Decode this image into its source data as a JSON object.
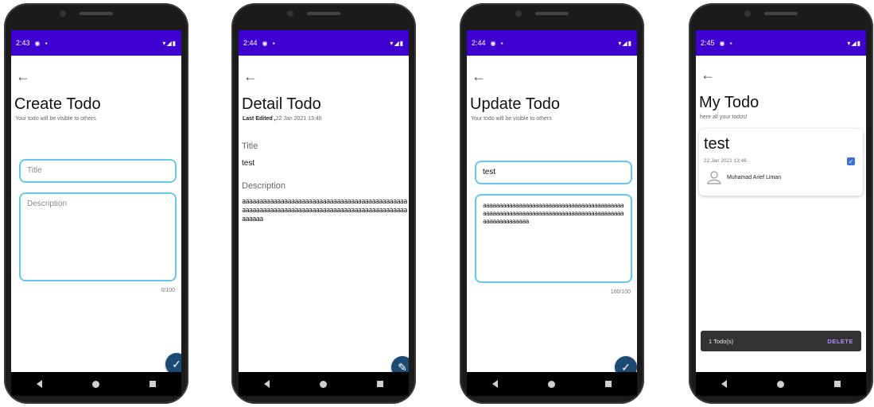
{
  "status_times": [
    "2:43",
    "2:44",
    "2:44",
    "2:45"
  ],
  "create": {
    "title": "Create Todo",
    "subtitle": "Your todo will be visible to others",
    "title_placeholder": "Title",
    "description_placeholder": "Description",
    "counter": "0/100"
  },
  "detail": {
    "title": "Detail Todo",
    "last_edited_label": "Last Edited ,",
    "last_edited_value": "22 Jan 2021 13:46",
    "title_label": "Title",
    "title_value": "test",
    "description_label": "Description",
    "description_value": "aaaaaaaaaaaaaaaaaaaaaaaaaaaaaaaaaaaaaaaaaaaaaaaaaaaaaaaaaaaaaaaaaaaaaaaaaaaaaaaaaaaaaaaaaaaaaaaaaaaa"
  },
  "update": {
    "title": "Update Todo",
    "subtitle": "Your todo will be visible to others",
    "title_value": "test",
    "description_value": "aaaaaaaaaaaaaaaaaaaaaaaaaaaaaaaaaaaaaaaaaaaaaaaaaaaaaaaaaaaaaaaaaaaaaaaaaaaaaaaaaaaaaaaaaaaaaaaaaaaa",
    "counter": "100/100"
  },
  "list": {
    "title": "My Todo",
    "subtitle": "here all your todos!",
    "card": {
      "title": "test",
      "date": "22 Jan 2021 13:46",
      "checked": true,
      "user": "Muhamad Arief Liman"
    },
    "snackbar": {
      "text": "1 Todo(s)",
      "action": "DELETE"
    }
  },
  "colors": {
    "status_bar": "#3d00d1",
    "fab": "#1d4a73",
    "field_border": "#66c6ef",
    "snackbar_action": "#b18cff",
    "checkbox": "#3f6fd8"
  },
  "icons": {
    "back": "arrow-left-icon",
    "save": "check-icon",
    "edit": "pencil-icon",
    "avatar": "person-icon"
  }
}
